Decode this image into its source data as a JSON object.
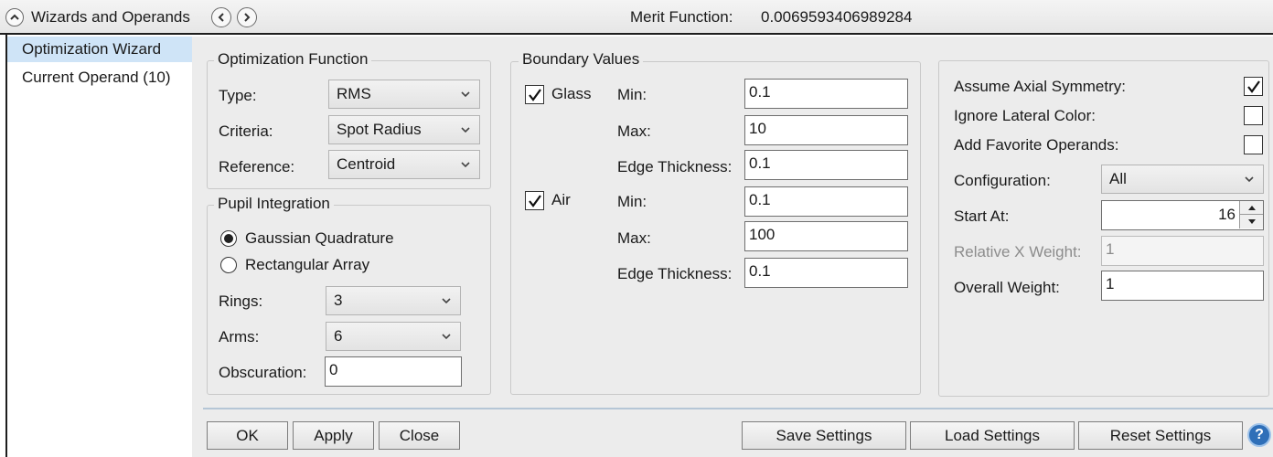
{
  "header": {
    "title": "Wizards and Operands",
    "merit_label": "Merit Function:",
    "merit_value": "0.0069593406989284"
  },
  "nav": {
    "items": [
      {
        "label": "Optimization Wizard",
        "selected": true
      },
      {
        "label": "Current Operand (10)",
        "selected": false
      }
    ]
  },
  "optimization_function": {
    "title": "Optimization Function",
    "type_label": "Type:",
    "type_value": "RMS",
    "criteria_label": "Criteria:",
    "criteria_value": "Spot Radius",
    "reference_label": "Reference:",
    "reference_value": "Centroid"
  },
  "pupil_integration": {
    "title": "Pupil Integration",
    "gaussian_label": "Gaussian Quadrature",
    "rectangular_label": "Rectangular Array",
    "selected": "Gaussian Quadrature",
    "rings_label": "Rings:",
    "rings_value": "3",
    "arms_label": "Arms:",
    "arms_value": "6",
    "obscuration_label": "Obscuration:",
    "obscuration_value": "0"
  },
  "boundary_values": {
    "title": "Boundary Values",
    "glass": {
      "label": "Glass",
      "checked": true,
      "min_label": "Min:",
      "min": "0.1",
      "max_label": "Max:",
      "max": "10",
      "edge_label": "Edge Thickness:",
      "edge": "0.1"
    },
    "air": {
      "label": "Air",
      "checked": true,
      "min_label": "Min:",
      "min": "0.1",
      "max_label": "Max:",
      "max": "100",
      "edge_label": "Edge Thickness:",
      "edge": "0.1"
    }
  },
  "options": {
    "axial_label": "Assume Axial Symmetry:",
    "axial_checked": true,
    "lateral_label": "Ignore Lateral Color:",
    "lateral_checked": false,
    "favorite_label": "Add Favorite Operands:",
    "favorite_checked": false,
    "configuration_label": "Configuration:",
    "configuration_value": "All",
    "start_label": "Start At:",
    "start_value": "16",
    "relx_label": "Relative X Weight:",
    "relx_value": "1",
    "overall_label": "Overall Weight:",
    "overall_value": "1"
  },
  "buttons": {
    "ok": "OK",
    "apply": "Apply",
    "close": "Close",
    "save": "Save Settings",
    "load": "Load Settings",
    "reset": "Reset Settings",
    "help": "?"
  },
  "colors": {
    "selection": "#cfe4f7",
    "panel": "#ececec",
    "help": "#2f6fb8"
  }
}
